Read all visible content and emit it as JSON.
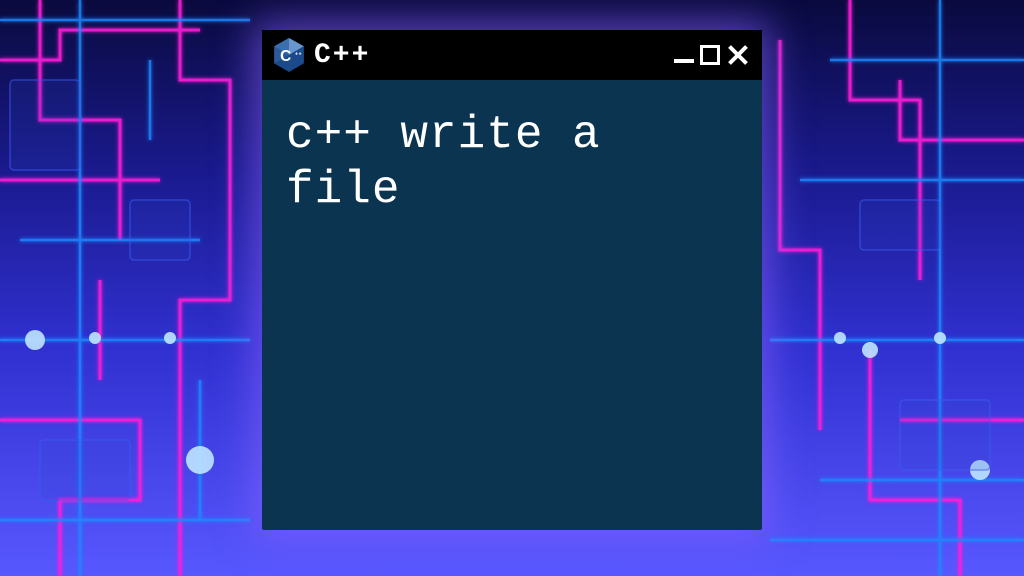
{
  "window": {
    "title": "C++",
    "body_text": "c++ write a file"
  },
  "icon": {
    "badge_letter": "C",
    "badge_plus": "++",
    "color_top": "#6a96d0",
    "color_bottom": "#1a4a8a",
    "color_mid": "#3b6fae"
  },
  "colors": {
    "titlebar_bg": "#000000",
    "window_bg": "#0a3450",
    "text": "#ffffff",
    "glow": "#8c64ff"
  },
  "background": {
    "style": "neon-circuit-board",
    "gradient_top": "#0a0a3e",
    "gradient_bottom": "#6060ff",
    "neon_pink": "#ff1ad9",
    "neon_blue": "#1a8aff"
  }
}
